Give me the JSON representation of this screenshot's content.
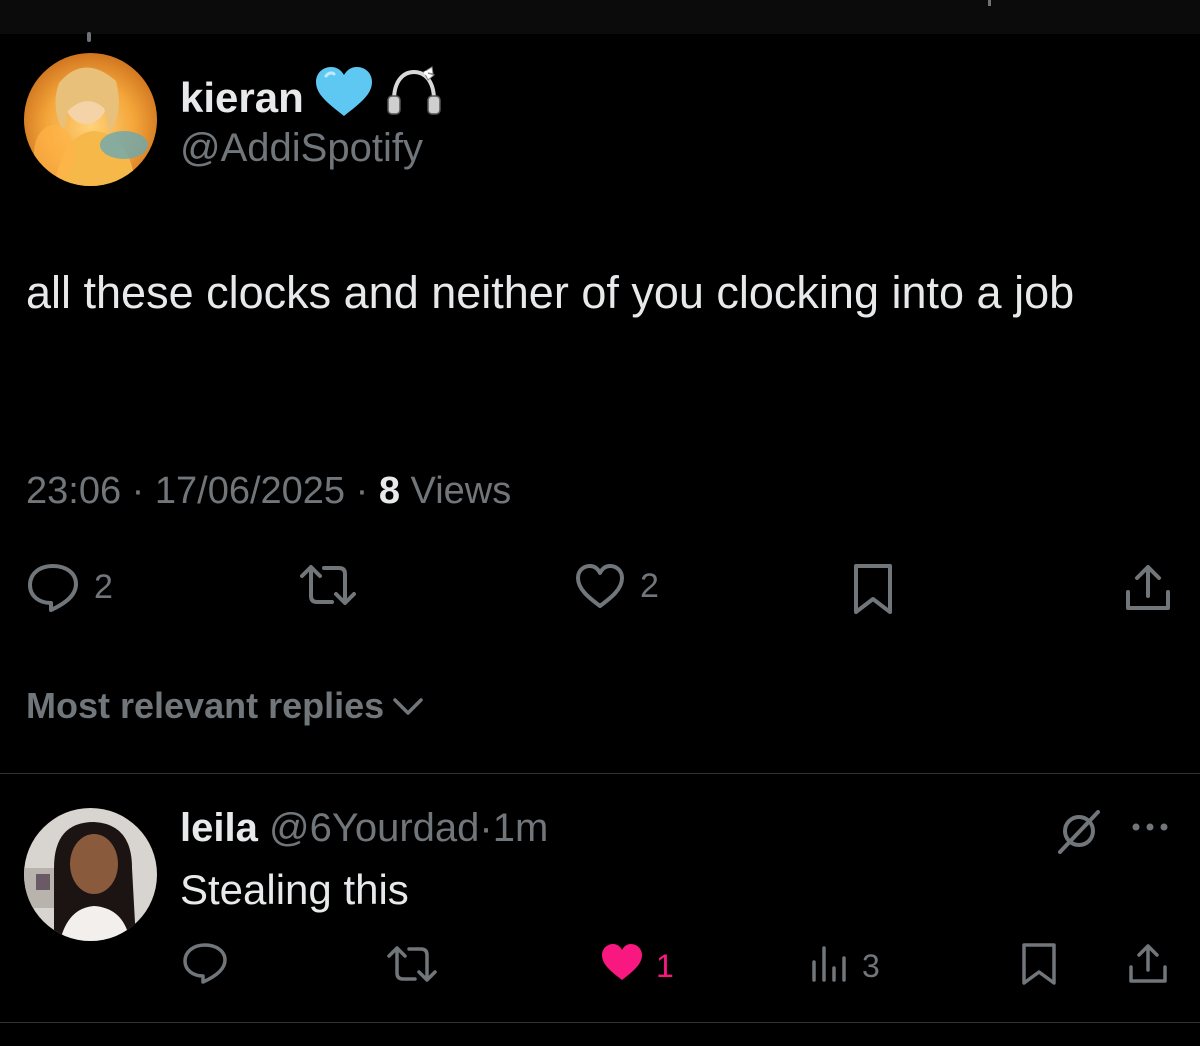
{
  "tweet": {
    "author_name": "kieran",
    "author_emojis": [
      "light-blue-heart-icon",
      "headphones-with-bow-icon"
    ],
    "author_handle": "@AddiSpotify",
    "text": "all these clocks and neither of you clocking into a job",
    "time": "23:06",
    "separator": "·",
    "date": "17/06/2025",
    "views_count": "8",
    "views_label": "Views",
    "reply_count": "2",
    "like_count": "2"
  },
  "replies_sort": {
    "label": "Most relevant replies"
  },
  "reply": {
    "name": "leila",
    "handle": "@6Yourdad",
    "separator": "·",
    "time": "1m",
    "text": "Stealing this",
    "like_count": "1",
    "views_count": "3",
    "liked": true
  },
  "colors": {
    "background": "#000000",
    "primary_text": "#e7e9ea",
    "secondary_text": "#71767b",
    "like_pink": "#f91880",
    "heart_blue": "#5ec8f2",
    "divider": "#2f3336"
  }
}
